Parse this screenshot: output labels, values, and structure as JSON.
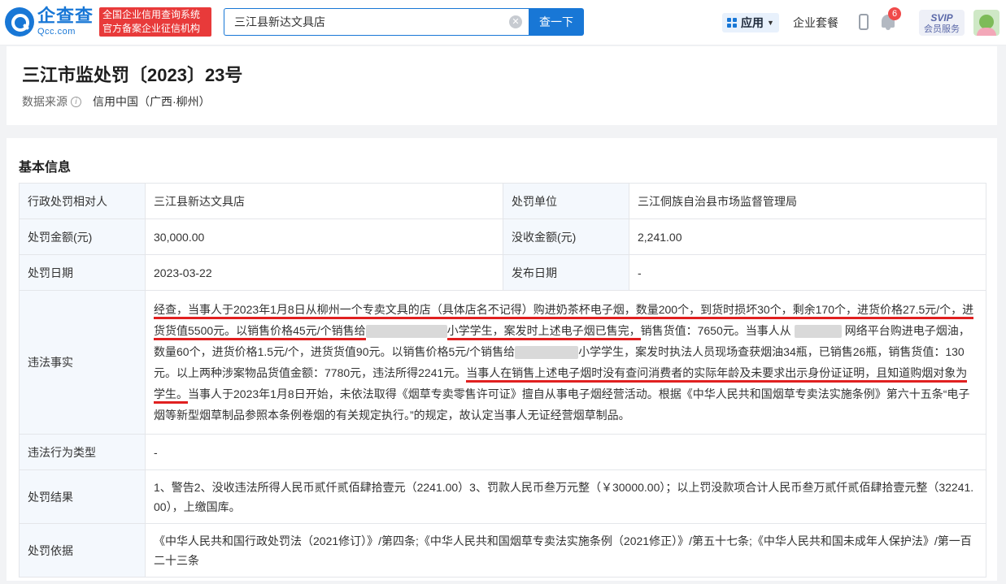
{
  "header": {
    "logo_cn": "企查查",
    "logo_en": "Qcc.com",
    "slogan_line1": "全国企业信用查询系统",
    "slogan_line2": "官方备案企业征信机构",
    "search_value": "三江县新达文具店",
    "search_button": "查一下",
    "nav_app": "应用",
    "nav_package": "企业套餐",
    "notification_count": "6",
    "svip_top": "SVIP",
    "svip_bottom": "会员服务"
  },
  "title_card": {
    "title": "三江市监处罚〔2023〕23号",
    "source_label": "数据来源",
    "source_value": "信用中国（广西·柳州）"
  },
  "basic_info": {
    "section_title": "基本信息",
    "party_label": "行政处罚相对人",
    "party_value": "三江县新达文具店",
    "unit_label": "处罚单位",
    "unit_value": "三江侗族自治县市场监督管理局",
    "amount_label": "处罚金额(元)",
    "amount_value": "30,000.00",
    "confiscate_label": "没收金额(元)",
    "confiscate_value": "2,241.00",
    "date_label": "处罚日期",
    "date_value": "2023-03-22",
    "publish_label": "发布日期",
    "publish_value": "-",
    "facts_label": "违法事实",
    "facts": {
      "p1": "经查，当事人于2023年1月8日从柳州一个专卖文具的店（具体店名不记得）购进奶茶杯电子烟，数量200个，到货时损坏30个，剩余170个，进货价格27.5元/个，",
      "p2": "进货货值5500元。以销售价格45元/个销售给",
      "p3": "小学学生，案发时上述电子烟已售完，",
      "p4": "销售货值：7650元。当事人从",
      "p5": "网络平台购进电子烟油，数量60个，进货价格1.5元/个，进货货值90元。以销售价格5元/个销售给",
      "p6": "小学学生，案发时执法人员现场查获烟油34瓶，已销售26瓶，销售货值：130元。以上两种涉案物品货值金额：7780元，违法所得2241元。",
      "p7": "当事人在销售上述电子烟时没有查问消费者的实际年龄及未要求出示身份证证明，且知道购烟对象为学生。",
      "p8": "当事人于2023年1月8日开始，未依法取得《烟草专卖零售许可证》擅自从事电子烟经营活动。根据《中华人民共和国烟草专卖法实施条例》第六十五条“电子烟等新型烟草制品参照本条例卷烟的有关规定执行。”的规定，故认定当事人无证经营烟草制品。"
    },
    "type_label": "违法行为类型",
    "type_value": "-",
    "result_label": "处罚结果",
    "result_value": "1、警告2、没收违法所得人民币贰仟贰佰肆拾壹元（2241.00）3、罚款人民币叁万元整（￥30000.00）；以上罚没款项合计人民币叁万贰仟贰佰肆拾壹元整（32241.00），上缴国库。",
    "basis_label": "处罚依据",
    "basis_value": "《中华人民共和国行政处罚法（2021修订）》/第四条;《中华人民共和国烟草专卖法实施条例（2021修正）》/第五十七条;《中华人民共和国未成年人保护法》/第一百二十三条"
  }
}
